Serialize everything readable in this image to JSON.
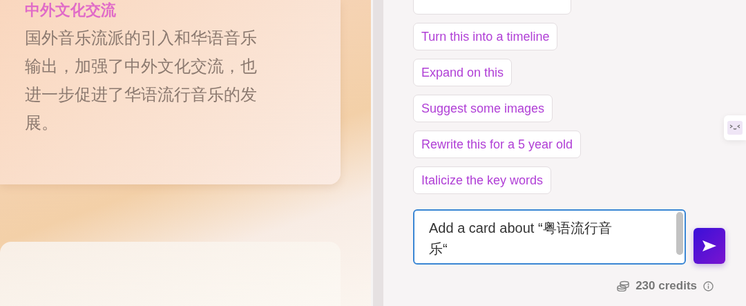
{
  "card": {
    "title": "中外文化交流",
    "body": "国外音乐流派的引入和华语音乐输出，加强了中外文化交流，也进一步促进了华语流行音乐的发展。"
  },
  "suggestions": [
    "Turn this into a timeline",
    "Expand on this",
    "Suggest some images",
    "Rewrite this for a 5 year old",
    "Italicize the key words"
  ],
  "prompt": {
    "value": "Add a card about “粤语流行音乐“"
  },
  "credits": "230 credits"
}
